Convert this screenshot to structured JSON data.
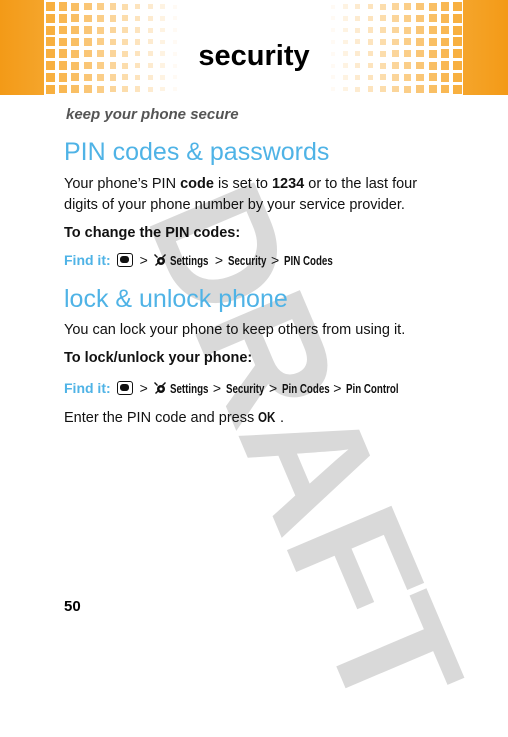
{
  "header": {
    "title": "security",
    "accent_color": "#f39a17"
  },
  "tagline": "keep your phone secure",
  "sections": [
    {
      "heading": "PIN codes & passwords",
      "paragraph": {
        "t1": "Your phone’s PIN ",
        "b1": "code",
        "t2": " is set to ",
        "b2": "1234",
        "t3": " or to the last four digits of your phone number by your service provider."
      },
      "subhead": "To change the PIN codes:",
      "find_it": {
        "label": "Find it:",
        "menu_icon": "menu-key-icon",
        "settings_icon": "settings-icon",
        "separator": ">",
        "path": [
          "Settings",
          "Security",
          "PIN Codes"
        ]
      }
    },
    {
      "heading": "lock & unlock phone",
      "paragraph": "You can lock your phone to keep others from using it.",
      "subhead": "To lock/unlock your phone:",
      "find_it": {
        "label": "Find it:",
        "menu_icon": "menu-key-icon",
        "settings_icon": "settings-icon",
        "separator": ">",
        "path": [
          "Settings",
          "Security",
          "Pin Codes",
          "Pin Control"
        ]
      },
      "instruction": {
        "t1": "Enter the PIN code and press ",
        "key": "OK",
        "t2": "."
      }
    }
  ],
  "watermark": "DRAFT",
  "page_number": "50",
  "colors": {
    "heading_blue": "#4fb3e6",
    "header_orange": "#f39a17"
  }
}
